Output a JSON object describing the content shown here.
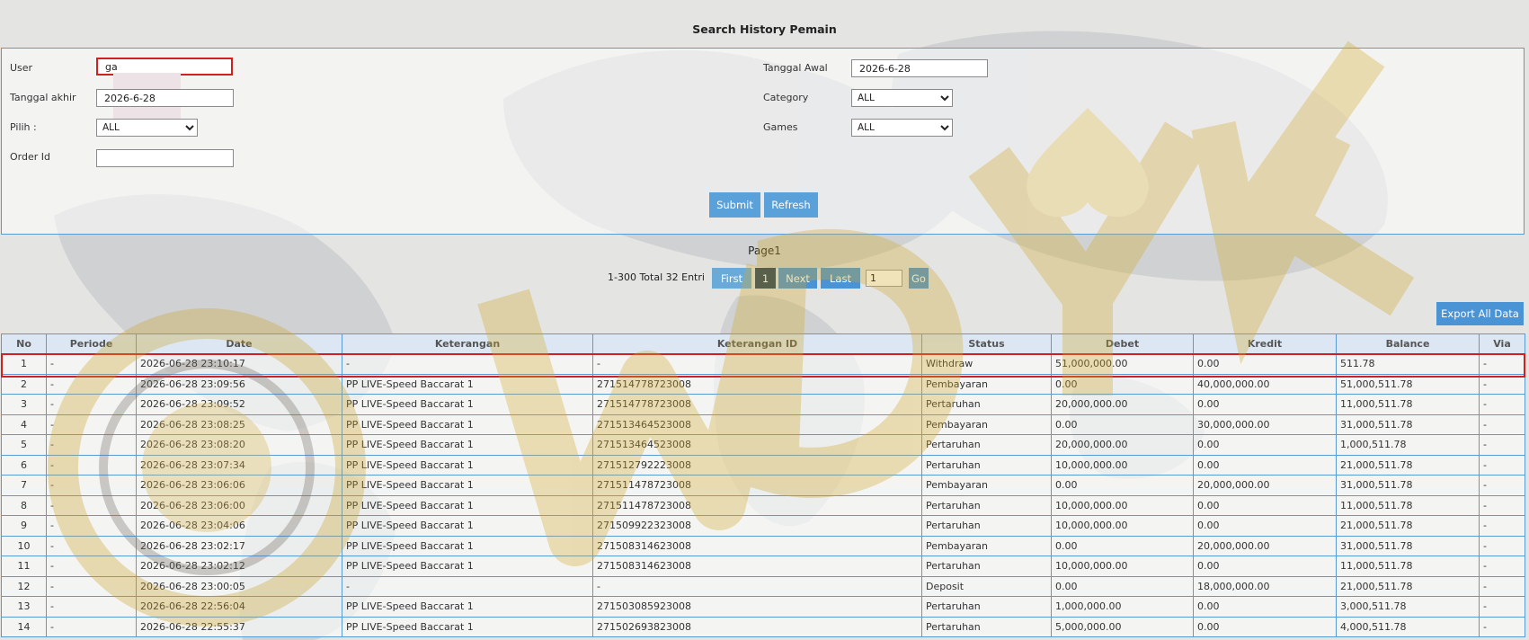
{
  "title": "Search History Pemain",
  "form": {
    "user_label": "User",
    "user_value": "ga",
    "tanggal_akhir_label": "Tanggal akhir",
    "tanggal_akhir_value": "2026-6-28",
    "pilih_label": "Pilih  :",
    "pilih_value": "ALL",
    "order_id_label": "Order Id",
    "order_id_value": "",
    "tanggal_awal_label": "Tanggal Awal",
    "tanggal_awal_value": "2026-6-28",
    "category_label": "Category",
    "category_value": "ALL",
    "games_label": "Games",
    "games_value": "ALL",
    "submit_label": "Submit",
    "refresh_label": "Refresh"
  },
  "pager": {
    "page_title": "Page1",
    "info": "1-300 Total 32 Entri",
    "first_label": "First",
    "current_page": "1",
    "next_label": "Next",
    "last_label": "Last",
    "go_input_value": "1",
    "go_label": "Go"
  },
  "export_label": "Export All Data",
  "table": {
    "headers": [
      "No",
      "Periode",
      "Date",
      "Keterangan",
      "Keterangan ID",
      "Status",
      "Debet",
      "Kredit",
      "Balance",
      "Via"
    ],
    "rows": [
      {
        "no": "1",
        "periode": "-",
        "date": "2026-06-28 23:10:17",
        "ket": "-",
        "ket_id": "-",
        "status": "Withdraw",
        "debet": "51,000,000.00",
        "kredit": "0.00",
        "balance": "511.78",
        "via": "-",
        "debet_color": "red",
        "kredit_color": "red",
        "highlight": true
      },
      {
        "no": "2",
        "periode": "-",
        "date": "2026-06-28 23:09:56",
        "ket": "PP LIVE-Speed Baccarat 1",
        "ket_id": "271514778723008",
        "status": "Pembayaran",
        "debet": "0.00",
        "kredit": "40,000,000.00",
        "balance": "51,000,511.78",
        "via": "-"
      },
      {
        "no": "3",
        "periode": "-",
        "date": "2026-06-28 23:09:52",
        "ket": "PP LIVE-Speed Baccarat 1",
        "ket_id": "271514778723008",
        "status": "Pertaruhan",
        "debet": "20,000,000.00",
        "kredit": "0.00",
        "balance": "11,000,511.78",
        "via": "-"
      },
      {
        "no": "4",
        "periode": "-",
        "date": "2026-06-28 23:08:25",
        "ket": "PP LIVE-Speed Baccarat 1",
        "ket_id": "271513464523008",
        "status": "Pembayaran",
        "debet": "0.00",
        "kredit": "30,000,000.00",
        "balance": "31,000,511.78",
        "via": "-"
      },
      {
        "no": "5",
        "periode": "-",
        "date": "2026-06-28 23:08:20",
        "ket": "PP LIVE-Speed Baccarat 1",
        "ket_id": "271513464523008",
        "status": "Pertaruhan",
        "debet": "20,000,000.00",
        "kredit": "0.00",
        "balance": "1,000,511.78",
        "via": "-"
      },
      {
        "no": "6",
        "periode": "-",
        "date": "2026-06-28 23:07:34",
        "ket": "PP LIVE-Speed Baccarat 1",
        "ket_id": "271512792223008",
        "status": "Pertaruhan",
        "debet": "10,000,000.00",
        "kredit": "0.00",
        "balance": "21,000,511.78",
        "via": "-"
      },
      {
        "no": "7",
        "periode": "-",
        "date": "2026-06-28 23:06:06",
        "ket": "PP LIVE-Speed Baccarat 1",
        "ket_id": "271511478723008",
        "status": "Pembayaran",
        "debet": "0.00",
        "kredit": "20,000,000.00",
        "balance": "31,000,511.78",
        "via": "-"
      },
      {
        "no": "8",
        "periode": "-",
        "date": "2026-06-28 23:06:00",
        "ket": "PP LIVE-Speed Baccarat 1",
        "ket_id": "271511478723008",
        "status": "Pertaruhan",
        "debet": "10,000,000.00",
        "kredit": "0.00",
        "balance": "11,000,511.78",
        "via": "-"
      },
      {
        "no": "9",
        "periode": "-",
        "date": "2026-06-28 23:04:06",
        "ket": "PP LIVE-Speed Baccarat 1",
        "ket_id": "271509922323008",
        "status": "Pertaruhan",
        "debet": "10,000,000.00",
        "kredit": "0.00",
        "balance": "21,000,511.78",
        "via": "-"
      },
      {
        "no": "10",
        "periode": "-",
        "date": "2026-06-28 23:02:17",
        "ket": "PP LIVE-Speed Baccarat 1",
        "ket_id": "271508314623008",
        "status": "Pembayaran",
        "debet": "0.00",
        "kredit": "20,000,000.00",
        "balance": "31,000,511.78",
        "via": "-"
      },
      {
        "no": "11",
        "periode": "-",
        "date": "2026-06-28 23:02:12",
        "ket": "PP LIVE-Speed Baccarat 1",
        "ket_id": "271508314623008",
        "status": "Pertaruhan",
        "debet": "10,000,000.00",
        "kredit": "0.00",
        "balance": "11,000,511.78",
        "via": "-"
      },
      {
        "no": "12",
        "periode": "-",
        "date": "2026-06-28 23:00:05",
        "ket": "-",
        "ket_id": "-",
        "status": "Deposit",
        "debet": "0.00",
        "kredit": "18,000,000.00",
        "balance": "21,000,511.78",
        "via": "-",
        "debet_color": "green",
        "kredit_color": "green"
      },
      {
        "no": "13",
        "periode": "-",
        "date": "2026-06-28 22:56:04",
        "ket": "PP LIVE-Speed Baccarat 1",
        "ket_id": "271503085923008",
        "status": "Pertaruhan",
        "debet": "1,000,000.00",
        "kredit": "0.00",
        "balance": "3,000,511.78",
        "via": "-"
      },
      {
        "no": "14",
        "periode": "-",
        "date": "2026-06-28 22:55:37",
        "ket": "PP LIVE-Speed Baccarat 1",
        "ket_id": "271502693823008",
        "status": "Pertaruhan",
        "debet": "5,000,000.00",
        "kredit": "0.00",
        "balance": "4,000,511.78",
        "via": "-"
      }
    ]
  },
  "colors": {
    "accent_blue": "#4a93d4",
    "border_blue": "#5b9bd5",
    "highlight_red": "#d21f1f",
    "deposit_green": "#1a8f1a",
    "link_blue": "#3f86c8"
  },
  "watermark_text": "WDYUK"
}
